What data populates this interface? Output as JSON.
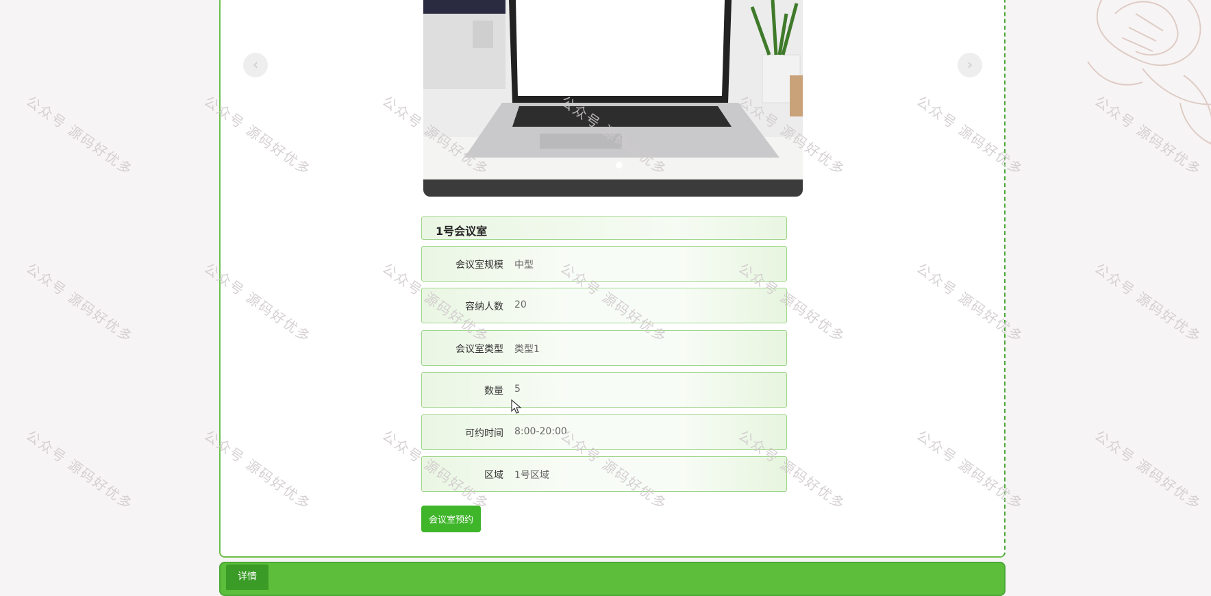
{
  "watermark_text": "公众号 源码好优多",
  "carousel": {
    "prev_icon": "‹",
    "next_icon": "›"
  },
  "room": {
    "title": "1号会议室",
    "fields": [
      {
        "label": "会议室规模",
        "value": "中型"
      },
      {
        "label": "容纳人数",
        "value": "20"
      },
      {
        "label": "会议室类型",
        "value": "类型1"
      },
      {
        "label": "数量",
        "value": "5"
      },
      {
        "label": "可约时间",
        "value": "8:00-20:00"
      },
      {
        "label": "区域",
        "value": "1号区域"
      }
    ]
  },
  "actions": {
    "reserve_label": "会议室预约"
  },
  "tabs": {
    "details_label": "详情"
  },
  "colors": {
    "accent": "#3fb52a",
    "border": "#9fd58a",
    "tab_dark": "#3a9b27"
  }
}
